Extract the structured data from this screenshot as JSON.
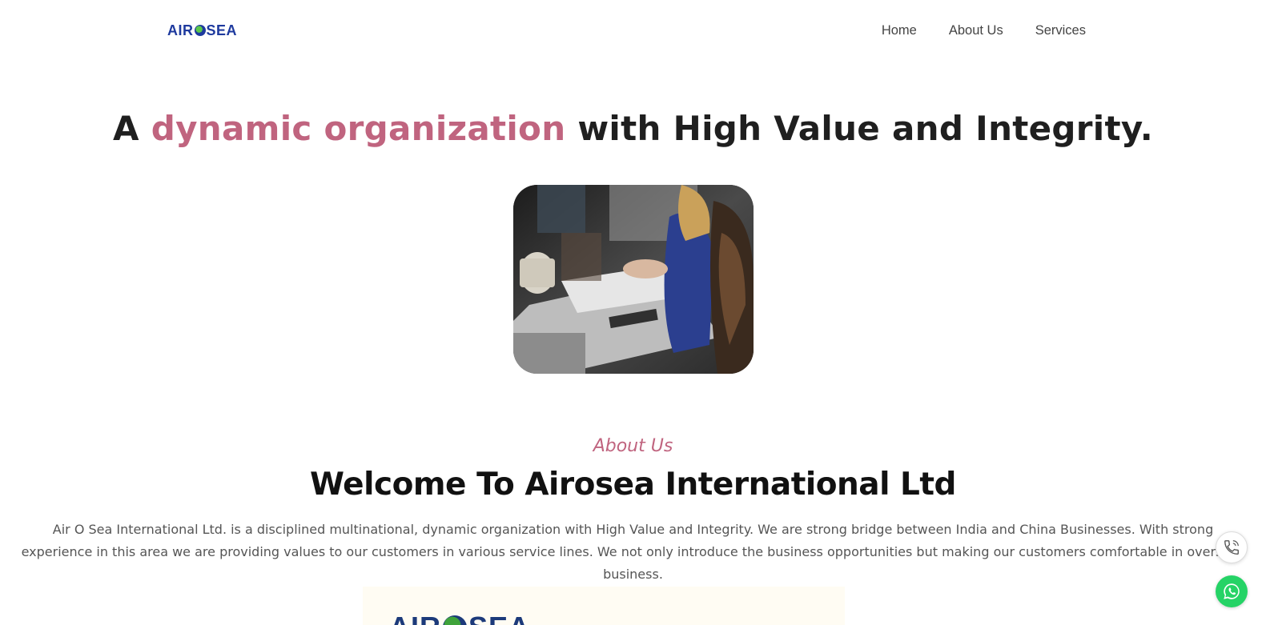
{
  "header": {
    "logo_text_left": "AIR",
    "logo_text_right": "SEA",
    "nav": [
      "Home",
      "About Us",
      "Services"
    ]
  },
  "hero": {
    "title_prefix": "A ",
    "title_accent": "dynamic organization",
    "title_suffix": " with High Value and Integrity.",
    "accent_color": "#c0647f"
  },
  "about": {
    "kicker": "About Us",
    "title": "Welcome To Airosea International Ltd",
    "paragraph": "Air O Sea International Ltd. is a disciplined multinational, dynamic organization with High Value and Integrity. We are strong bridge between India and China Businesses. With strong experience in this area we are providing values to our customers in various service lines. We not only introduce the business opportunities but making our customers comfortable in overseas business."
  },
  "logo_card": {
    "text_left": "AIR",
    "text_right": "SEA"
  },
  "floating": {
    "call_icon": "phone-icon",
    "whatsapp_icon": "whatsapp-icon"
  }
}
